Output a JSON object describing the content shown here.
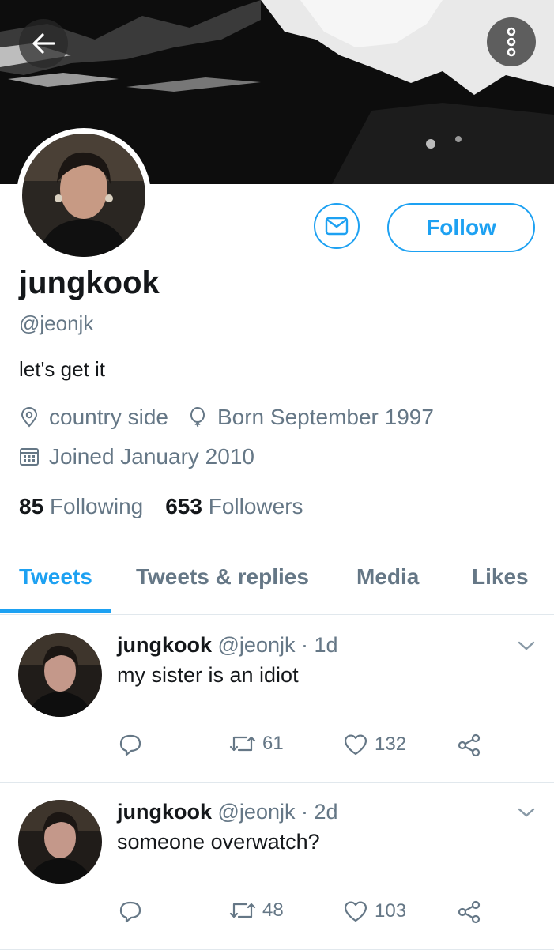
{
  "profile": {
    "name": "jungkook",
    "handle": "@jeonjk",
    "bio": "let's get it",
    "location": "country side",
    "birthday": "Born September 1997",
    "joined": "Joined January 2010",
    "following_count": "85",
    "following_label": "Following",
    "followers_count": "653",
    "followers_label": "Followers"
  },
  "header": {
    "follow_label": "Follow",
    "back_icon": "arrow-left-icon",
    "more_icon": "more-vertical-icon",
    "message_icon": "envelope-icon"
  },
  "tabs": [
    {
      "label": "Tweets",
      "active": true
    },
    {
      "label": "Tweets & replies",
      "active": false
    },
    {
      "label": "Media",
      "active": false
    },
    {
      "label": "Likes",
      "active": false
    }
  ],
  "tweets": [
    {
      "name": "jungkook",
      "handle": "@jeonjk",
      "time": "· 1d",
      "text": "my sister is an idiot",
      "retweets": "61",
      "likes": "132"
    },
    {
      "name": "jungkook",
      "handle": "@jeonjk",
      "time": "· 2d",
      "text": "someone overwatch?",
      "retweets": "48",
      "likes": "103"
    }
  ],
  "colors": {
    "accent": "#1da1f2",
    "secondary_text": "#657786",
    "primary_text": "#14171a",
    "divider": "#e1e8ed"
  }
}
